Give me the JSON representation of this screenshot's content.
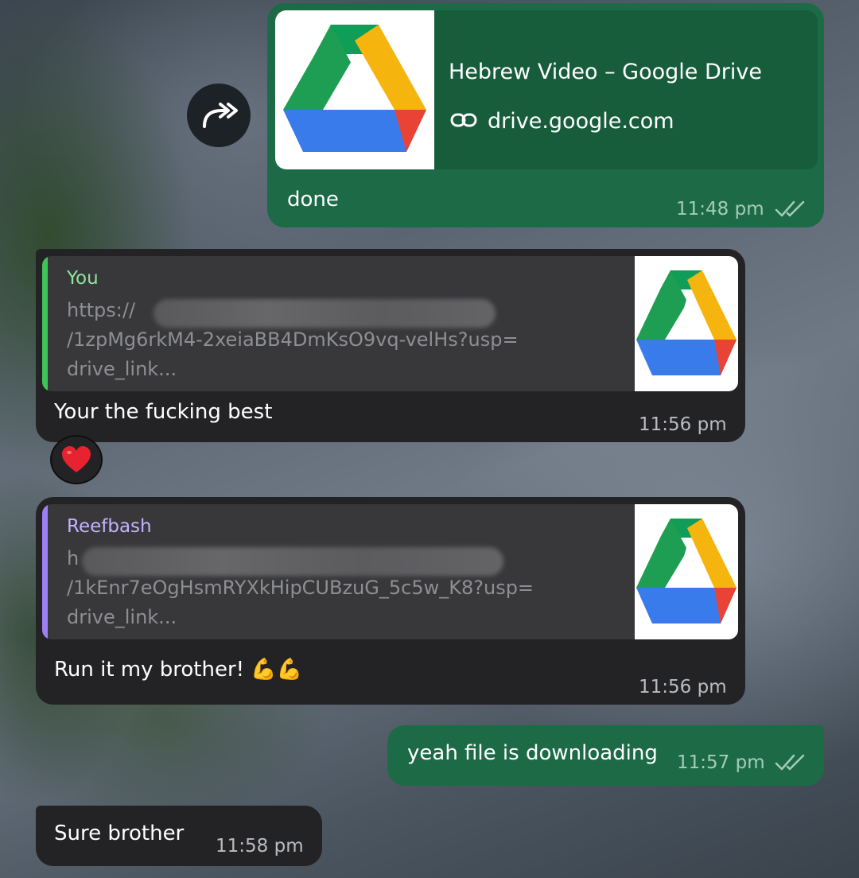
{
  "messages": {
    "m1": {
      "link_title": "Hebrew Video – Google Drive",
      "link_domain": "drive.google.com",
      "text": "done",
      "time": "11:48 pm",
      "status": "read"
    },
    "m2": {
      "reply_name": "You",
      "reply_line1": "https://",
      "reply_line2": "/1zpMg6rkM4-2xeiaBB4DmKsO9vq-velHs?usp=",
      "reply_line3": "drive_link...",
      "text": "Your the fucking best",
      "time": "11:56 pm",
      "reaction": "❤️"
    },
    "m3": {
      "reply_name": "Reefbash",
      "reply_line1": "h",
      "reply_line2": "/1kEnr7eOgHsmRYXkHipCUBzuG_5c5w_K8?usp=",
      "reply_line3": "drive_link...",
      "text": "Run it my brother! 💪💪",
      "time": "11:56 pm"
    },
    "m4": {
      "text": "yeah file is downloading",
      "time": "11:57 pm",
      "status": "read"
    },
    "m5": {
      "text": "Sure brother",
      "time": "11:58 pm"
    }
  },
  "colors": {
    "incoming_bubble": "#232325",
    "outgoing_bubble": "#1d6a47",
    "reply_you_accent": "#3fc45a",
    "reply_reefbash_accent": "#9d7ff5"
  },
  "icons": [
    "forward-icon",
    "link-icon",
    "double-check-icon",
    "google-drive-icon",
    "heart-reaction"
  ]
}
